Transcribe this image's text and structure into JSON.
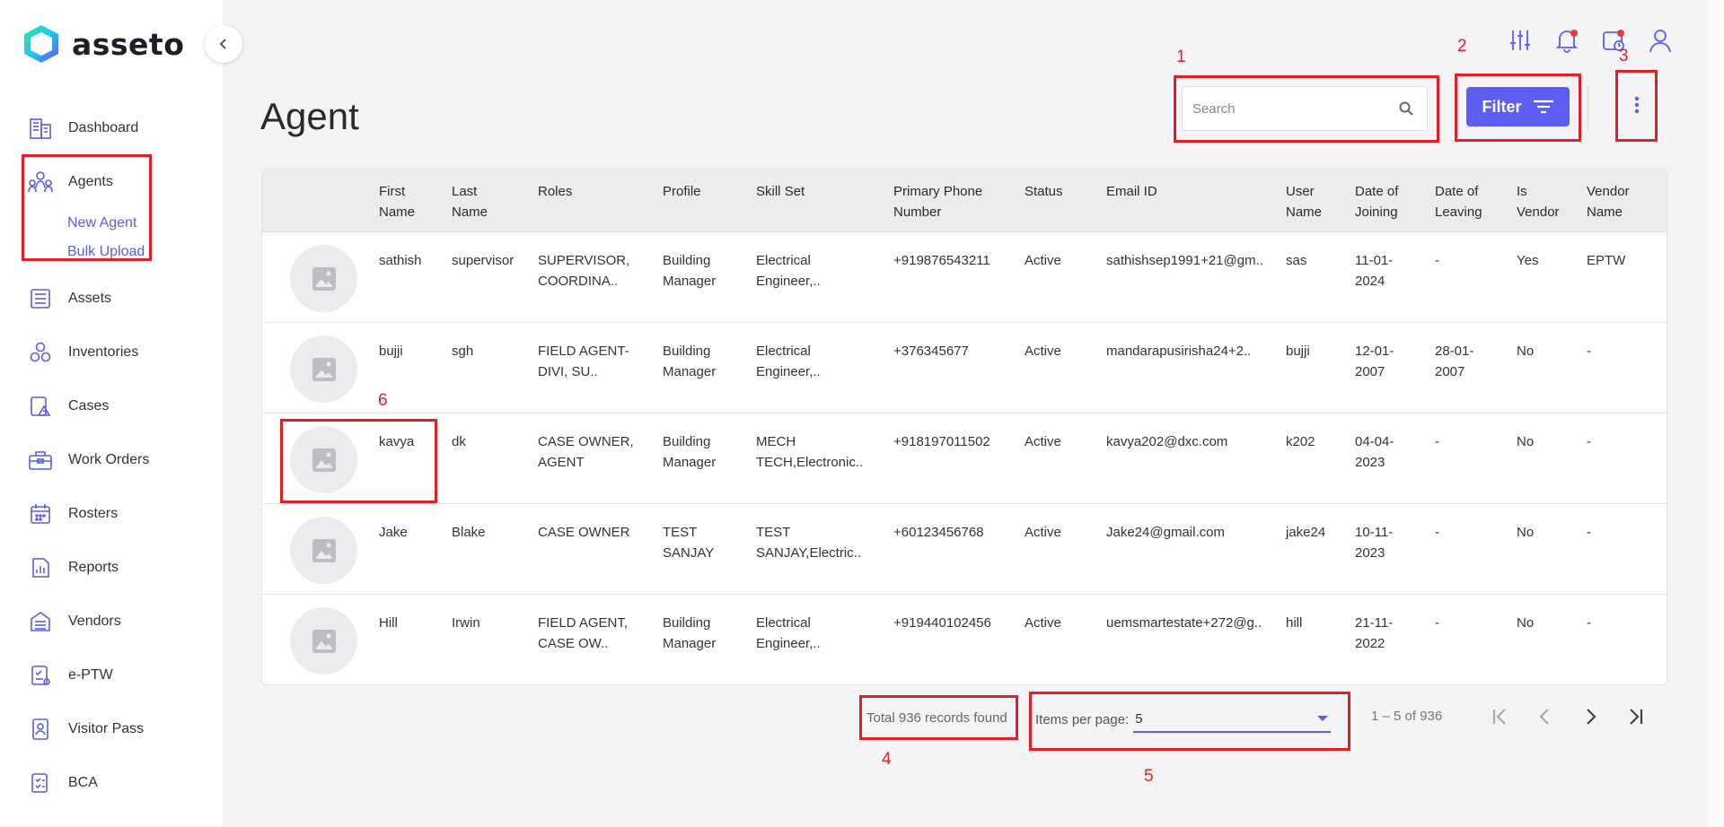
{
  "app": {
    "name": "asseto"
  },
  "sidebar": {
    "items": [
      {
        "label": "Dashboard",
        "icon": "dashboard-icon"
      },
      {
        "label": "Agents",
        "icon": "agents-icon",
        "subitems": [
          {
            "label": "New Agent"
          },
          {
            "label": "Bulk Upload"
          }
        ]
      },
      {
        "label": "Assets",
        "icon": "assets-icon"
      },
      {
        "label": "Inventories",
        "icon": "inventories-icon"
      },
      {
        "label": "Cases",
        "icon": "cases-icon"
      },
      {
        "label": "Work Orders",
        "icon": "work-orders-icon"
      },
      {
        "label": "Rosters",
        "icon": "rosters-icon"
      },
      {
        "label": "Reports",
        "icon": "reports-icon"
      },
      {
        "label": "Vendors",
        "icon": "vendors-icon"
      },
      {
        "label": "e-PTW",
        "icon": "eptw-icon"
      },
      {
        "label": "Visitor Pass",
        "icon": "visitor-pass-icon"
      },
      {
        "label": "BCA",
        "icon": "bca-icon"
      }
    ]
  },
  "header": {
    "title": "Agent",
    "search_placeholder": "Search",
    "filter_label": "Filter"
  },
  "table": {
    "columns": [
      {
        "line1": "First",
        "line2": "Name"
      },
      {
        "line1": "Last",
        "line2": "Name"
      },
      {
        "line1": "Roles",
        "line2": ""
      },
      {
        "line1": "Profile",
        "line2": ""
      },
      {
        "line1": "Skill Set",
        "line2": ""
      },
      {
        "line1": "Primary Phone",
        "line2": "Number"
      },
      {
        "line1": "Status",
        "line2": ""
      },
      {
        "line1": "Email ID",
        "line2": ""
      },
      {
        "line1": "User",
        "line2": "Name"
      },
      {
        "line1": "Date of",
        "line2": "Joining"
      },
      {
        "line1": "Date of",
        "line2": "Leaving"
      },
      {
        "line1": "Is",
        "line2": "Vendor"
      },
      {
        "line1": "Vendor",
        "line2": "Name"
      }
    ],
    "rows": [
      {
        "first_name": "sathish",
        "last_name": "supervisor",
        "roles1": "SUPERVISOR,",
        "roles2": "COORDINA..",
        "profile1": "Building",
        "profile2": "Manager",
        "skill1": "Electrical",
        "skill2": "Engineer,..",
        "phone": "+919876543211",
        "status": "Active",
        "email": "sathishsep1991+21@gm..",
        "username": "sas",
        "doj1": "11-01-",
        "doj2": "2024",
        "dol1": "-",
        "dol2": "",
        "is_vendor": "Yes",
        "vendor_name": "EPTW"
      },
      {
        "first_name": "bujji",
        "last_name": "sgh",
        "roles1": "FIELD AGENT-",
        "roles2": "DIVI, SU..",
        "profile1": "Building",
        "profile2": "Manager",
        "skill1": "Electrical",
        "skill2": "Engineer,..",
        "phone": "+376345677",
        "status": "Active",
        "email": "mandarapusirisha24+2..",
        "username": "bujji",
        "doj1": "12-01-",
        "doj2": "2007",
        "dol1": "28-01-",
        "dol2": "2007",
        "is_vendor": "No",
        "vendor_name": "-"
      },
      {
        "first_name": "kavya",
        "last_name": "dk",
        "roles1": "CASE OWNER,",
        "roles2": "AGENT",
        "profile1": "Building",
        "profile2": "Manager",
        "skill1": "MECH",
        "skill2": "TECH,Electronic..",
        "phone": "+918197011502",
        "status": "Active",
        "email": "kavya202@dxc.com",
        "username": "k202",
        "doj1": "04-04-",
        "doj2": "2023",
        "dol1": "-",
        "dol2": "",
        "is_vendor": "No",
        "vendor_name": "-"
      },
      {
        "first_name": "Jake",
        "last_name": "Blake",
        "roles1": "CASE OWNER",
        "roles2": "",
        "profile1": "TEST",
        "profile2": "SANJAY",
        "skill1": "TEST",
        "skill2": "SANJAY,Electric..",
        "phone": "+60123456768",
        "status": "Active",
        "email": "Jake24@gmail.com",
        "username": "jake24",
        "doj1": "10-11-",
        "doj2": "2023",
        "dol1": "-",
        "dol2": "",
        "is_vendor": "No",
        "vendor_name": "-"
      },
      {
        "first_name": "Hill",
        "last_name": "Irwin",
        "roles1": "FIELD AGENT,",
        "roles2": "CASE OW..",
        "profile1": "Building",
        "profile2": "Manager",
        "skill1": "Electrical",
        "skill2": "Engineer,..",
        "phone": "+919440102456",
        "status": "Active",
        "email": "uemsmartestate+272@g..",
        "username": "hill",
        "doj1": "21-11-",
        "doj2": "2022",
        "dol1": "-",
        "dol2": "",
        "is_vendor": "No",
        "vendor_name": "-"
      }
    ]
  },
  "footer": {
    "records": "Total 936 records found",
    "items_per_page_label": "Items per page:",
    "items_per_page_value": "5",
    "range": "1 – 5 of 936"
  },
  "annotations": [
    "1",
    "2",
    "3",
    "4",
    "5",
    "6"
  ],
  "colors": {
    "accent": "#5b5ef0",
    "annotation": "#e41e26",
    "sub_link": "#5a5ce6"
  }
}
